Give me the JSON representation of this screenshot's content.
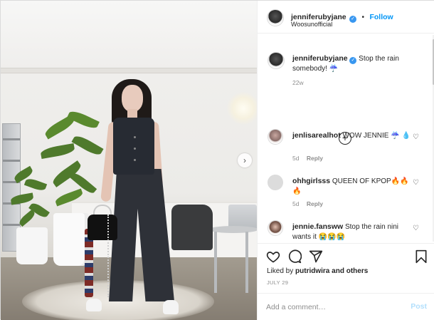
{
  "post": {
    "username": "jenniferubyjane",
    "location": "Woosunofficial",
    "follow_label": "Follow",
    "separator": "•",
    "caption": "Stop the rain somebody! ☔",
    "caption_age": "22w",
    "load_more_icon": "plus-circle-icon",
    "comments": [
      {
        "username": "jenlisarealhot",
        "text": "WOW JENNIE ☔ 💧",
        "age": "5d",
        "reply_label": "Reply",
        "avatar_color": "#8a6e6a"
      },
      {
        "username": "ohhgirlsss",
        "text": "QUEEN OF KPOP🔥🔥🔥",
        "age": "5d",
        "reply_label": "Reply",
        "avatar_color": "#dcdcdc"
      },
      {
        "username": "jennie.fansww",
        "text": "Stop the rain nini wants it 😭😭😭",
        "age": "",
        "reply_label": "",
        "avatar_color": "#6b4a3e"
      }
    ],
    "liked_by_prefix": "Liked by",
    "liked_by_user": "putridwira",
    "liked_by_suffix": "and others",
    "date": "JULY 29",
    "add_comment_placeholder": "Add a comment…",
    "post_label": "Post",
    "colors": {
      "accent": "#0095f6",
      "post_disabled": "#b2dffc",
      "muted": "#8e8e8e",
      "verified": "#3897f0"
    },
    "icons": [
      "heart-icon",
      "comment-icon",
      "share-icon",
      "save-icon",
      "chevron-right-icon",
      "verified-badge-icon"
    ]
  }
}
